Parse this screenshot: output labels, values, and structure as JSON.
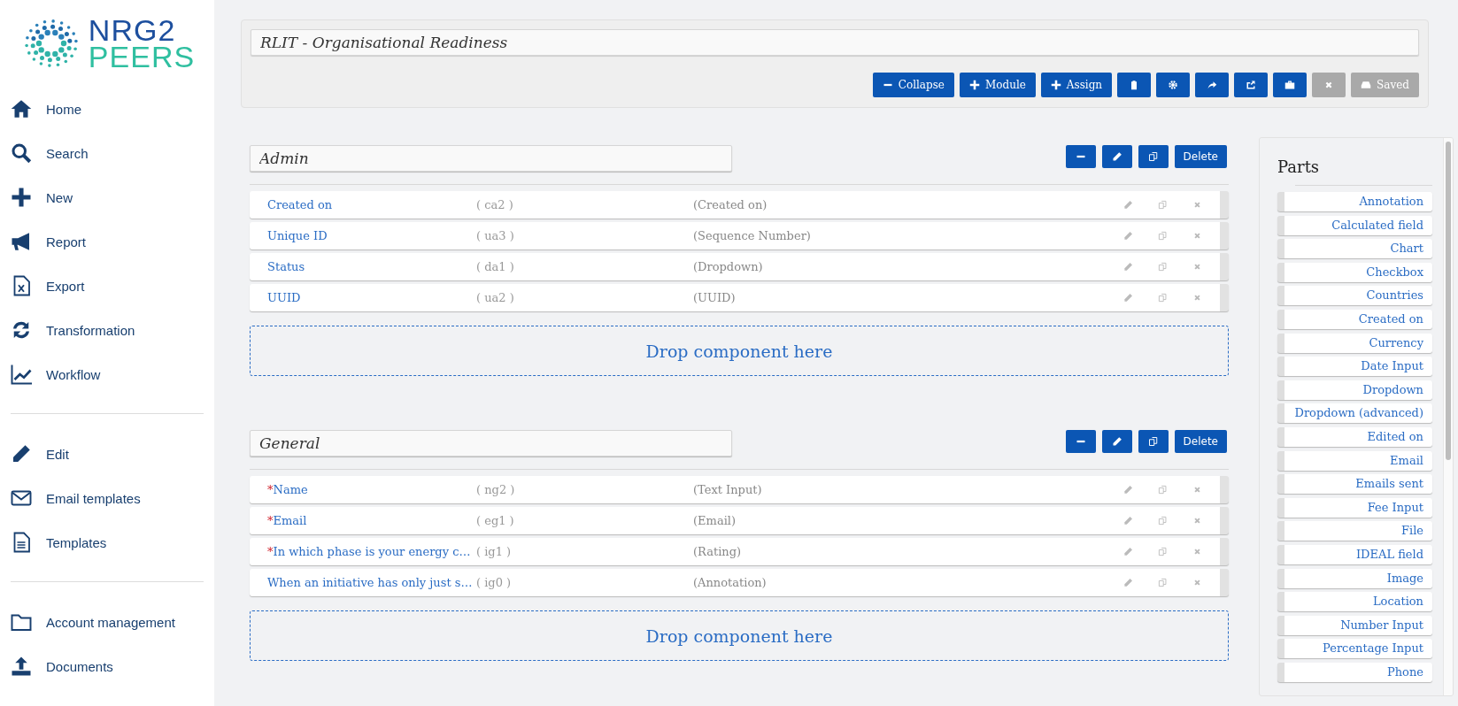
{
  "sidebar": {
    "logo": {
      "line_1": "NRG2",
      "line_2": "PEERS"
    },
    "groups": [
      {
        "items": [
          {
            "label": "Home"
          },
          {
            "label": "Search"
          },
          {
            "label": "New"
          },
          {
            "label": "Report"
          },
          {
            "label": "Export"
          },
          {
            "label": "Transformation"
          },
          {
            "label": "Workflow"
          }
        ]
      },
      {
        "items": [
          {
            "label": "Edit"
          },
          {
            "label": "Email templates"
          },
          {
            "label": "Templates"
          }
        ]
      },
      {
        "items": [
          {
            "label": "Account management"
          },
          {
            "label": "Documents"
          }
        ]
      }
    ]
  },
  "header": {
    "title": "RLIT - Organisational Readiness",
    "buttons": [
      {
        "label": "Collapse",
        "disabled": false
      },
      {
        "label": "Module",
        "disabled": false
      },
      {
        "label": "Assign",
        "disabled": false
      },
      {
        "disabled": false
      },
      {
        "disabled": false
      },
      {
        "disabled": false
      },
      {
        "disabled": false
      },
      {
        "disabled": false
      },
      {
        "disabled": true
      },
      {
        "label": "Saved",
        "disabled": true
      }
    ]
  },
  "modules": [
    {
      "title": "Admin",
      "delete_label": "Delete",
      "drop_label": "Drop component here",
      "fields": [
        {
          "name": "Created on",
          "code": "( ca2 )",
          "type": "(Created on)"
        },
        {
          "name": "Unique ID",
          "code": "( ua3 )",
          "type": "(Sequence Number)"
        },
        {
          "name": "Status",
          "code": "( da1 )",
          "type": "(Dropdown)"
        },
        {
          "name": "UUID",
          "code": "( ua2 )",
          "type": "(UUID)"
        }
      ]
    },
    {
      "title": "General",
      "delete_label": "Delete",
      "drop_label": "Drop component here",
      "fields": [
        {
          "required_mark": "*",
          "name": "Name",
          "code": "( ng2 )",
          "type": "(Text Input)"
        },
        {
          "required_mark": "*",
          "name": "Email",
          "code": "( eg1 )",
          "type": "(Email)"
        },
        {
          "required_mark": "*",
          "name": "In which phase is your energy c…",
          "code": "( ig1 )",
          "type": "(Rating)"
        },
        {
          "name": "When an initiative has only just s…",
          "code": "( ig0 )",
          "type": "(Annotation)"
        }
      ]
    }
  ],
  "parts": {
    "title": "Parts",
    "items": [
      "Annotation",
      "Calculated field",
      "Chart",
      "Checkbox",
      "Countries",
      "Created on",
      "Currency",
      "Date Input",
      "Dropdown",
      "Dropdown (advanced)",
      "Edited on",
      "Email",
      "Emails sent",
      "Fee Input",
      "File",
      "IDEAL field",
      "Image",
      "Location",
      "Number Input",
      "Percentage Input",
      "Phone"
    ]
  }
}
